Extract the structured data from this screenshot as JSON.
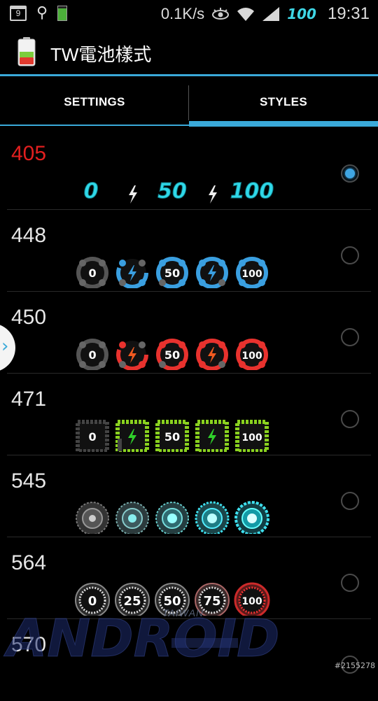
{
  "status_bar": {
    "left_icons": [
      "calendar-icon",
      "usb-icon",
      "battery-small-icon"
    ],
    "calendar_day": "9",
    "network_speed": "0.1K/s",
    "right_icons": [
      "eye-icon",
      "wifi-icon",
      "signal-icon"
    ],
    "battery_badge": "100",
    "time": "19:31"
  },
  "action_bar": {
    "title": "TW電池樣式",
    "icon": "battery-app-icon"
  },
  "tabs": [
    {
      "label": "SETTINGS",
      "selected": false
    },
    {
      "label": "STYLES",
      "selected": true
    }
  ],
  "styles": [
    {
      "id": "405",
      "selected": true,
      "kind": "text",
      "color": "#2fd8e8",
      "labels": [
        "0",
        "50",
        "100"
      ]
    },
    {
      "id": "448",
      "selected": false,
      "kind": "dots",
      "color": "#3a9fe0",
      "labels": [
        "0",
        "50",
        "100"
      ]
    },
    {
      "id": "450",
      "selected": false,
      "kind": "dots",
      "color": "#e8322e",
      "labels": [
        "0",
        "50",
        "100"
      ]
    },
    {
      "id": "471",
      "selected": false,
      "kind": "square",
      "color": "#8ad21f",
      "labels": [
        "0",
        "50",
        "100"
      ]
    },
    {
      "id": "545",
      "selected": false,
      "kind": "glow",
      "color": "#3ee0ef",
      "labels": []
    },
    {
      "id": "564",
      "selected": false,
      "kind": "dial",
      "color": "#cc2a2a",
      "labels": [
        "0",
        "25",
        "50",
        "75",
        "100"
      ]
    },
    {
      "id": "570",
      "selected": false,
      "kind": "none",
      "color": "#ffffff",
      "labels": []
    }
  ],
  "watermark": {
    "logo_text": "ANDROID",
    "region": "TAIWAN",
    "image_id": "#2155278"
  },
  "side_handle": {
    "glyph": "›"
  }
}
